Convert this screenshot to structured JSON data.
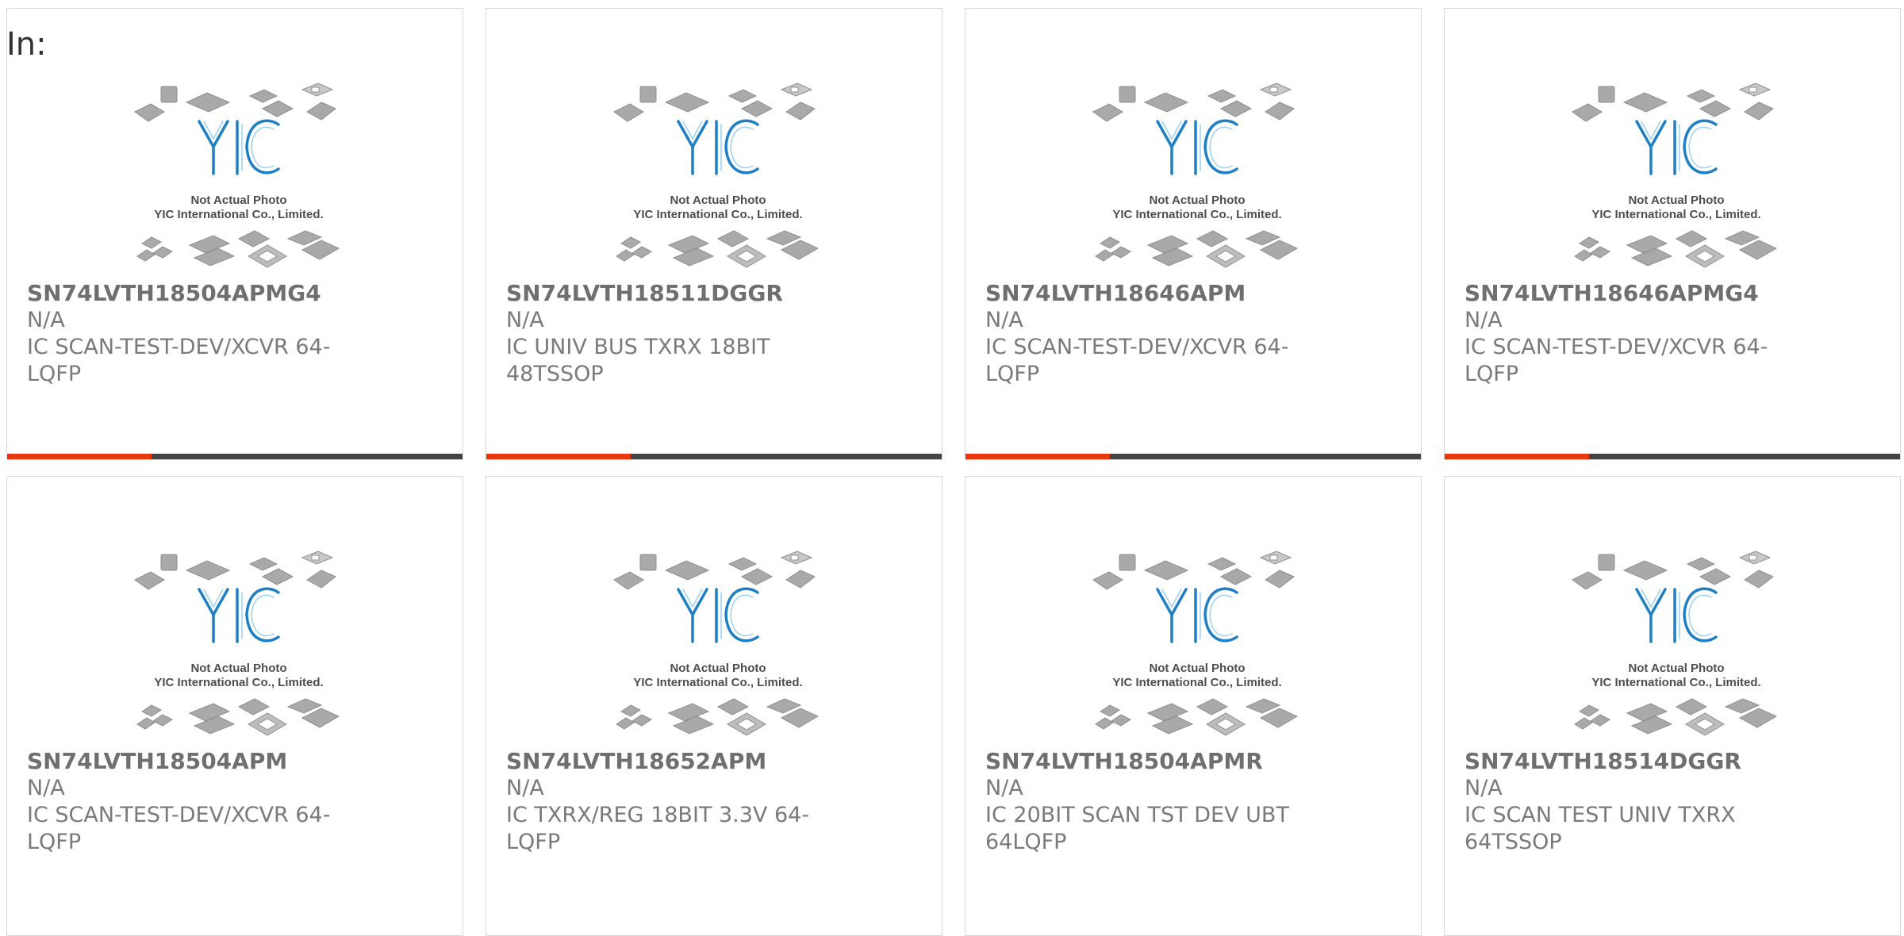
{
  "page": {
    "label": "In:"
  },
  "colors": {
    "accent": "#e8380d",
    "bar": "#444444",
    "border": "#d8d8d8",
    "logo": "#1f7fc4"
  },
  "placeholder_image": {
    "line1": "Not Actual Photo",
    "line2": "YIC International Co., Limited.",
    "logo_text": "YIC"
  },
  "products": [
    {
      "part": "SN74LVTH18504APMG4",
      "manufacturer": "N/A",
      "description": "IC SCAN-TEST-DEV/XCVR 64-LQFP"
    },
    {
      "part": "SN74LVTH18511DGGR",
      "manufacturer": "N/A",
      "description": "IC UNIV BUS TXRX 18BIT 48TSSOP"
    },
    {
      "part": "SN74LVTH18646APM",
      "manufacturer": "N/A",
      "description": "IC SCAN-TEST-DEV/XCVR 64-LQFP"
    },
    {
      "part": "SN74LVTH18646APMG4",
      "manufacturer": "N/A",
      "description": "IC SCAN-TEST-DEV/XCVR 64-LQFP"
    },
    {
      "part": "SN74LVTH18504APM",
      "manufacturer": "N/A",
      "description": "IC SCAN-TEST-DEV/XCVR 64-LQFP"
    },
    {
      "part": "SN74LVTH18652APM",
      "manufacturer": "N/A",
      "description": "IC TXRX/REG 18BIT 3.3V 64-LQFP"
    },
    {
      "part": "SN74LVTH18504APMR",
      "manufacturer": "N/A",
      "description": "IC 20BIT SCAN TST DEV UBT 64LQFP"
    },
    {
      "part": "SN74LVTH18514DGGR",
      "manufacturer": "N/A",
      "description": "IC SCAN TEST UNIV TXRX 64TSSOP"
    }
  ]
}
